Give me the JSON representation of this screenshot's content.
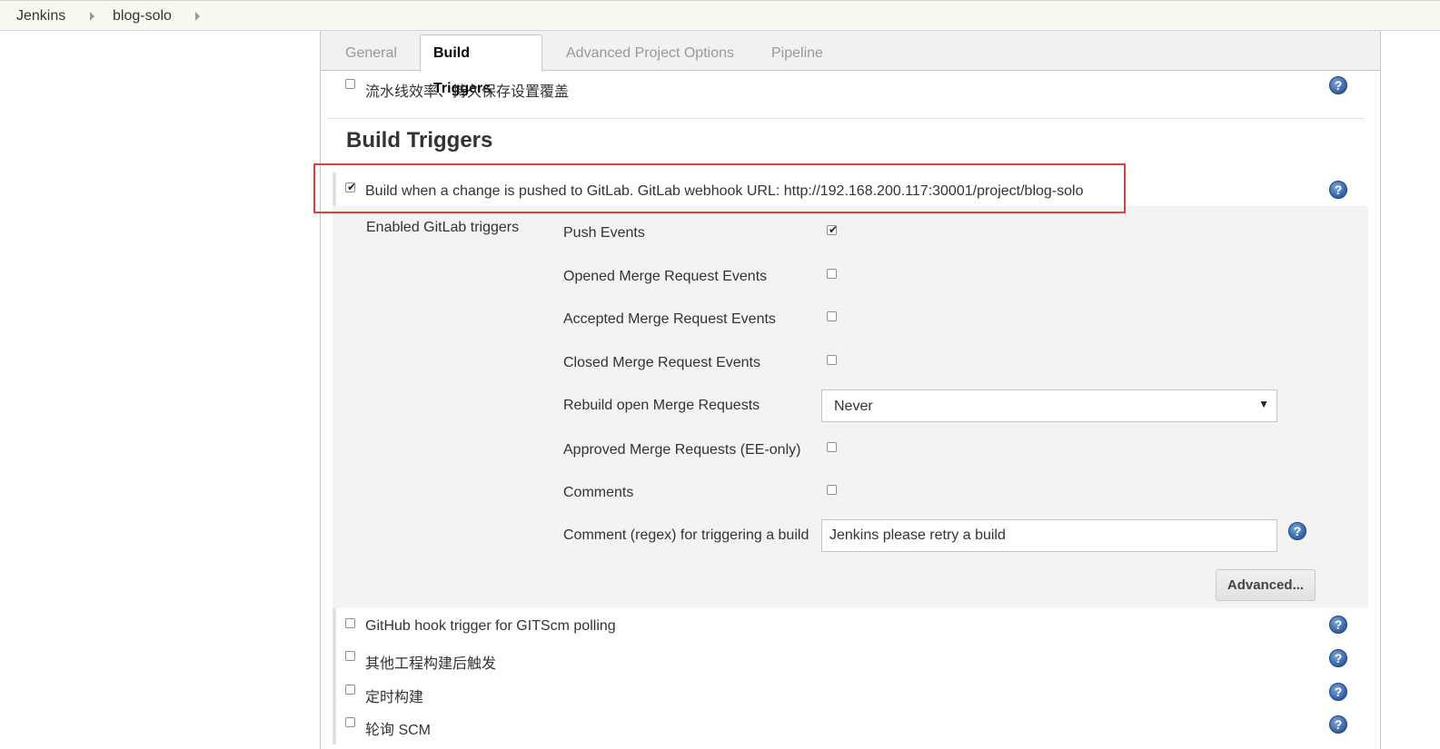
{
  "breadcrumb": {
    "items": [
      "Jenkins",
      "blog-solo"
    ]
  },
  "tabs": [
    "General",
    "Build Triggers",
    "Advanced Project Options",
    "Pipeline"
  ],
  "active_tab": "Build Triggers",
  "pipeline_override": {
    "label": "流水线效率、持久保存设置覆盖",
    "checked": false
  },
  "section": {
    "title": "Build Triggers"
  },
  "gitlab_trigger": {
    "label": "Build when a change is pushed to GitLab. GitLab webhook URL: http://192.168.200.117:30001/project/blog-solo",
    "checked": true
  },
  "gitlab_options": {
    "group_label": "Enabled GitLab triggers",
    "push_events": {
      "label": "Push Events",
      "checked": true
    },
    "opened_mr": {
      "label": "Opened Merge Request Events",
      "checked": false
    },
    "accepted_mr": {
      "label": "Accepted Merge Request Events",
      "checked": false
    },
    "closed_mr": {
      "label": "Closed Merge Request Events",
      "checked": false
    },
    "rebuild_mr": {
      "label": "Rebuild open Merge Requests",
      "value": "Never"
    },
    "approved_mr": {
      "label": "Approved Merge Requests (EE-only)",
      "checked": false
    },
    "comments": {
      "label": "Comments",
      "checked": false
    },
    "comment_regex": {
      "label": "Comment (regex) for triggering a build",
      "value": "Jenkins please retry a build"
    },
    "advanced_button": "Advanced..."
  },
  "other_triggers": {
    "github_hook": {
      "label": "GitHub hook trigger for GITScm polling",
      "checked": false
    },
    "after_other_projects": {
      "label": "其他工程构建后触发",
      "checked": false
    },
    "scheduled_build": {
      "label": "定时构建",
      "checked": false
    },
    "poll_scm": {
      "label": "轮询 SCM",
      "checked": false
    }
  },
  "help_glyph": "?",
  "colors": {
    "highlight": "#e0403d",
    "help_icon": "#2f5fa4",
    "breadcrumb_bg": "#f9f9f2"
  }
}
